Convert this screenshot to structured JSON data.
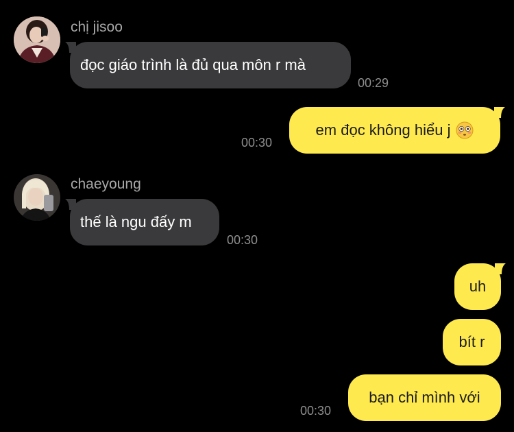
{
  "messages": [
    {
      "sender": "chị jisoo",
      "text": "đọc giáo trình là đủ qua môn r mà",
      "time": "00:29",
      "direction": "incoming",
      "avatar_icon": "avatar-jisoo-photo"
    },
    {
      "text": "em đọc không hiểu j",
      "emoji": "flushed-face-emoji",
      "time": "00:30",
      "direction": "outgoing"
    },
    {
      "sender": "chaeyoung",
      "text": "thế là ngu đấy m",
      "time": "00:30",
      "direction": "incoming",
      "avatar_icon": "avatar-chaeyoung-photo"
    },
    {
      "text": "uh",
      "direction": "outgoing"
    },
    {
      "text": "bít r",
      "direction": "outgoing"
    },
    {
      "text": "bạn chỉ mình với",
      "time": "00:30",
      "direction": "outgoing"
    }
  ],
  "colors": {
    "background": "#000000",
    "incoming_bubble": "#3a3a3c",
    "outgoing_bubble": "#fee94e",
    "sender_name": "#a8a8a8",
    "timestamp": "#8e8e8e"
  }
}
